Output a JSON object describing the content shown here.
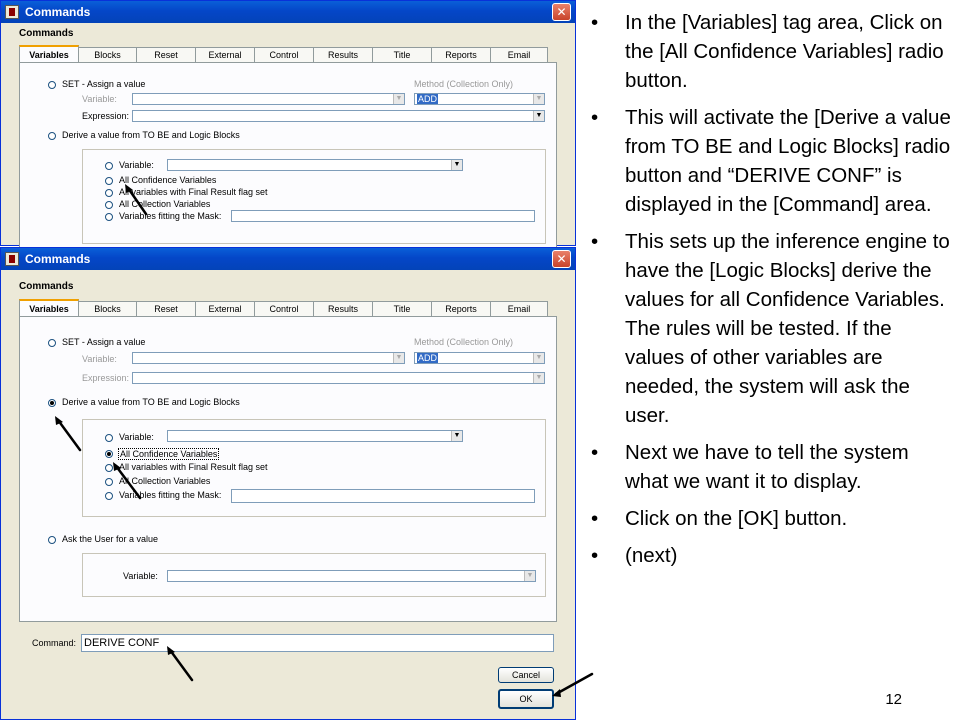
{
  "window_top": {
    "title": "Commands",
    "section_label": "Commands",
    "tabs": [
      "Variables",
      "Blocks",
      "Reset",
      "External",
      "Control",
      "Results",
      "Title",
      "Reports",
      "Email"
    ],
    "set_label": "SET - Assign a value",
    "method_label": "Method (Collection Only)",
    "variable_label": "Variable:",
    "method_value": "ADD",
    "expression_label": "Expression:",
    "derive_label": "Derive a value from TO BE and Logic Blocks",
    "sub_variable_label": "Variable:",
    "options": [
      "All Confidence Variables",
      "All variables with Final Result flag set",
      "All Collection Variables",
      "Variables fitting the Mask:"
    ]
  },
  "window_main": {
    "title": "Commands",
    "section_label": "Commands",
    "tabs": [
      "Variables",
      "Blocks",
      "Reset",
      "External",
      "Control",
      "Results",
      "Title",
      "Reports",
      "Email"
    ],
    "set_label": "SET - Assign a value",
    "method_label": "Method (Collection Only)",
    "variable_label": "Variable:",
    "method_value": "ADD",
    "expression_label": "Expression:",
    "derive_label": "Derive a value from TO BE and Logic Blocks",
    "sub_variable_label": "Variable:",
    "options": [
      "All Confidence Variables",
      "All variables with Final Result flag set",
      "All Collection Variables",
      "Variables fitting the Mask:"
    ],
    "ask_label": "Ask the User for a value",
    "ask_variable_label": "Variable:",
    "command_label": "Command:",
    "command_value": "DERIVE CONF",
    "cancel_label": "Cancel",
    "ok_label": "OK"
  },
  "bullets": [
    "In the [Variables] tag area, Click on the [All Confidence Variables] radio button.",
    "This will activate the [Derive a value from TO BE and Logic Blocks] radio button and “DERIVE CONF” is displayed in the [Command] area.",
    "This sets up the inference engine to have the [Logic Blocks] derive the values for all Confidence Variables.  The rules will be tested.  If the values of other variables are needed, the system will ask the user.",
    "Next we have to tell the system what we want it to display.",
    "Click on the [OK] button.",
    "(next)"
  ],
  "bullet_glyph": "•",
  "page_number": "12",
  "icons": {
    "close": "close-icon",
    "dropdown": "chevron-down-icon",
    "arrow": "pointer-arrow-icon"
  },
  "colors": {
    "titlebar": "#0446c8",
    "dialog_bg": "#ece9d8",
    "selection": "#316ac5"
  }
}
